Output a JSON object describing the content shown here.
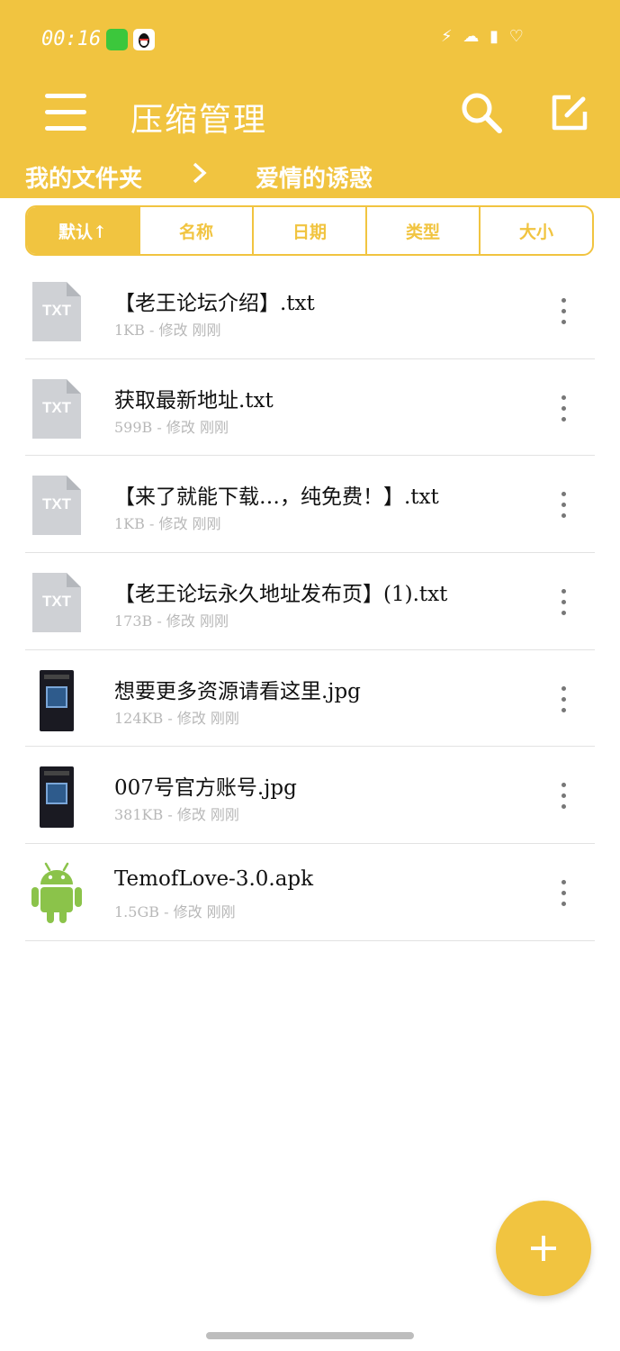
{
  "status_bar": {
    "time": "00:16",
    "right_icons": "⚡ ☁ ▮ ♡"
  },
  "app_bar": {
    "title": "压缩管理"
  },
  "breadcrumb": {
    "root": "我的文件夹",
    "current": "爱情的诱惑"
  },
  "sort_tabs": [
    {
      "label": "默认↑"
    },
    {
      "label": "名称"
    },
    {
      "label": "日期"
    },
    {
      "label": "类型"
    },
    {
      "label": "大小"
    }
  ],
  "files": [
    {
      "name": "【老王论坛介绍】.txt",
      "meta": "1KB - 修改 刚刚",
      "icon": "txt"
    },
    {
      "name": "获取最新地址.txt",
      "meta": "599B - 修改 刚刚",
      "icon": "txt"
    },
    {
      "name": "【来了就能下载…，纯免费！】.txt",
      "meta": "1KB - 修改 刚刚",
      "icon": "txt"
    },
    {
      "name": "【老王论坛永久地址发布页】(1).txt",
      "meta": "173B - 修改 刚刚",
      "icon": "txt"
    },
    {
      "name": "想要更多资源请看这里.jpg",
      "meta": "124KB - 修改 刚刚",
      "icon": "image"
    },
    {
      "name": "007号官方账号.jpg",
      "meta": "381KB - 修改 刚刚",
      "icon": "image"
    },
    {
      "name": "TemofLove-3.0.apk",
      "meta": "1.5GB - 修改 刚刚",
      "icon": "android"
    }
  ],
  "txt_icon_label": "TXT",
  "colors": {
    "accent": "#f1c440",
    "android_green": "#8bc34a",
    "divider": "#e2e2e2",
    "meta_text": "#b8b8b8"
  },
  "icons": {
    "menu": "menu-icon",
    "search": "search-icon",
    "edit": "edit-icon",
    "more": "more-vert-icon",
    "fab": "plus-icon"
  }
}
